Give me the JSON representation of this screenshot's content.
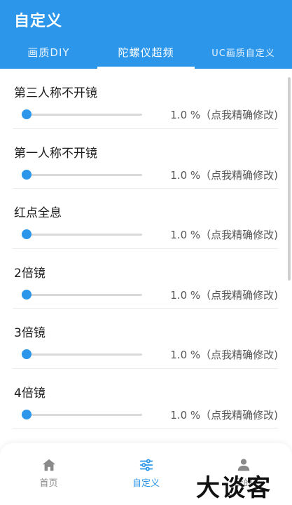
{
  "app": {
    "title": "自定义"
  },
  "tabs": [
    {
      "label": "画质DIY"
    },
    {
      "label": "陀螺仪超频"
    },
    {
      "label": "UC画质自定义"
    }
  ],
  "items": [
    {
      "label": "第三人称不开镜",
      "value": "1.0 %（点我精确修改)",
      "level": 0.0
    },
    {
      "label": "第一人称不开镜",
      "value": "1.0 %（点我精确修改)",
      "level": 0.0
    },
    {
      "label": "红点全息",
      "value": "1.0 %（点我精确修改)",
      "level": 0.0
    },
    {
      "label": "2倍镜",
      "value": "1.0 %（点我精确修改)",
      "level": 0.0
    },
    {
      "label": "3倍镜",
      "value": "1.0 %（点我精确修改)",
      "level": 0.0
    },
    {
      "label": "4倍镜",
      "value": "1.0 %（点我精确修改)",
      "level": 0.0
    }
  ],
  "nav": [
    {
      "label": "首页",
      "icon": "home-icon"
    },
    {
      "label": "自定义",
      "icon": "sliders-icon"
    },
    {
      "label": "我的",
      "icon": "person-icon"
    }
  ],
  "watermark": "大谈客",
  "colors": {
    "accent": "#2b96ea"
  }
}
